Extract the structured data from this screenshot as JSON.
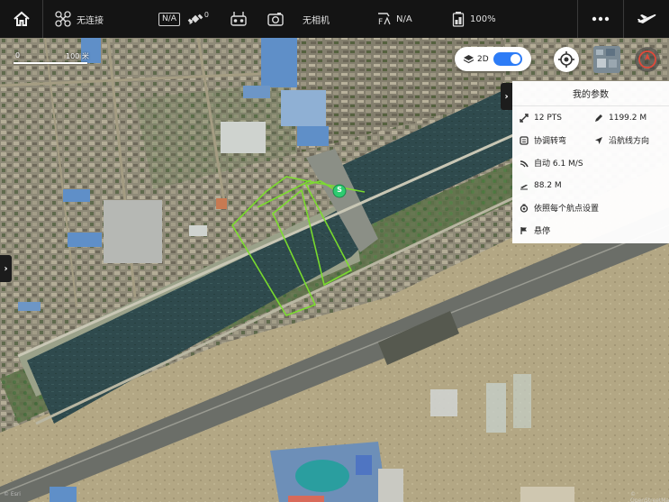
{
  "topbar": {
    "connection_label": "无连接",
    "gps_mode": "N/A",
    "satellite_count": "0",
    "camera_label": "无相机",
    "signal_label": "N/A",
    "battery_label": "100%"
  },
  "map": {
    "view_mode_label": "2D",
    "view_mode_enabled": true,
    "scale": {
      "zero_label": "0",
      "distance_label": "100 米"
    },
    "waypoint_label": "S",
    "attribution_left": "© Esri",
    "attribution_right": "© OpenStreetMap"
  },
  "param_panel": {
    "title": "我的参数",
    "rows": [
      {
        "left_icon": "waypoint-count-icon",
        "left": "12 PTS",
        "right_icon": "distance-pen-icon",
        "right": "1199.2 M"
      },
      {
        "left_icon": "turn-mode-icon",
        "left": "协调转弯",
        "right_icon": "heading-arrow-icon",
        "right": "沿航线方向"
      },
      {
        "left_icon": "speed-icon",
        "left": "自动  6.1 M/S"
      },
      {
        "left_icon": "altitude-icon",
        "left": "88.2 M"
      },
      {
        "left_icon": "camera-action-icon",
        "left": "依照每个航点设置"
      },
      {
        "left_icon": "finish-flag-icon",
        "left": "悬停"
      }
    ]
  },
  "colors": {
    "topbar_bg": "#141414",
    "toggle_accent": "#2d7cf6",
    "flight_path": "#7be02c",
    "waypoint_marker": "#2ecc71"
  }
}
